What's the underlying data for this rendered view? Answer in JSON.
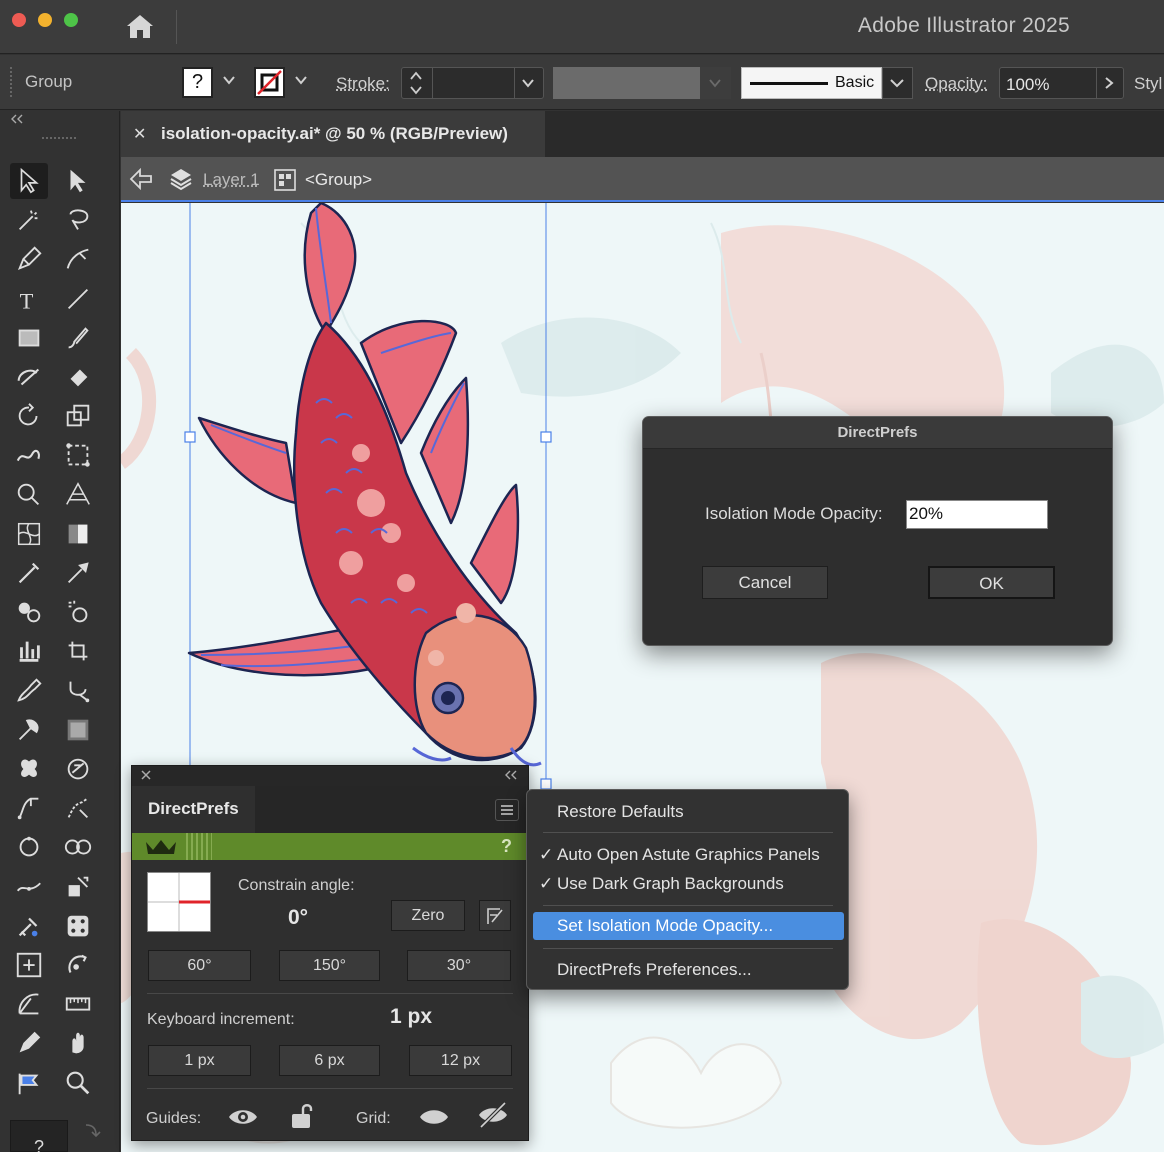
{
  "window": {
    "app_title": "Adobe Illustrator 2025"
  },
  "control_bar": {
    "selection_label": "Group",
    "fill_swatch_symbol": "?",
    "stroke_label": "Stroke:",
    "brush_label": "Basic",
    "opacity_label": "Opacity:",
    "opacity_value": "100%",
    "style_label": "Styl"
  },
  "document_tab": {
    "close_symbol": "✕",
    "title": "isolation-opacity.ai* @ 50 % (RGB/Preview)"
  },
  "isolation_bar": {
    "layer_label": "Layer 1",
    "group_label": "<Group>"
  },
  "dialog": {
    "title": "DirectPrefs",
    "field_label": "Isolation Mode Opacity:",
    "field_value": "20%",
    "cancel_label": "Cancel",
    "ok_label": "OK"
  },
  "directprefs_panel": {
    "tab_title": "DirectPrefs",
    "help_symbol": "?",
    "constrain_label": "Constrain angle:",
    "constrain_value": "0°",
    "zero_label": "Zero",
    "angle_presets": [
      "60°",
      "150°",
      "30°"
    ],
    "keyboard_label": "Keyboard increment:",
    "keyboard_value": "1 px",
    "increment_presets": [
      "1 px",
      "6 px",
      "12 px"
    ],
    "guides_label": "Guides:",
    "grid_label": "Grid:"
  },
  "context_menu": {
    "items": [
      {
        "label": "Restore Defaults",
        "checked": false,
        "highlighted": false
      },
      {
        "label": "Auto Open Astute Graphics Panels",
        "checked": true,
        "highlighted": false
      },
      {
        "label": "Use Dark Graph Backgrounds",
        "checked": true,
        "highlighted": false
      },
      {
        "label": "Set Isolation Mode Opacity...",
        "checked": false,
        "highlighted": true
      },
      {
        "label": "DirectPrefs Preferences...",
        "checked": false,
        "highlighted": false
      }
    ],
    "check_symbol": "✓"
  },
  "toolbar": {
    "bottom_symbol": "?",
    "tools": [
      "selection-tool",
      "direct-selection-tool",
      "magic-wand-tool",
      "lasso-tool",
      "pen-tool",
      "curvature-tool",
      "type-tool",
      "line-segment-tool",
      "rectangle-tool",
      "paintbrush-tool",
      "shaper-tool",
      "eraser-tool",
      "rotate-tool",
      "scale-tool",
      "warp-tool",
      "free-transform-tool",
      "shape-builder-tool",
      "perspective-grid-tool",
      "mesh-tool",
      "gradient-tool",
      "eyedropper-tool",
      "eyedropper-alt-tool",
      "blend-tool",
      "symbol-sprayer-tool",
      "column-graph-tool",
      "artboard-tool",
      "brush-tool",
      "width-tool",
      "smart-brush-tool",
      "texture-tool",
      "butterfly-tool",
      "zoom-tool",
      "path-tool",
      "direct-path-tool",
      "circle-tool",
      "infinity-tool",
      "stroke-tool",
      "transform-tool",
      "dropper-tool",
      "dice-tool",
      "reflect-tool",
      "rotate-arrow-tool",
      "angle-tool",
      "ruler-tool",
      "pen-alt-tool",
      "hand-tool",
      "flag-tool",
      "zoom-alt-tool"
    ]
  },
  "colors": {
    "accent_blue": "#4a80e8",
    "menu_highlight": "#4a8ee0",
    "panel_green": "#5f8a2a",
    "koi_red": "#c9374a",
    "koi_salmon": "#e8907c",
    "koi_fin_blue": "#5868d8",
    "canvas_bg": "#eef7f8"
  }
}
